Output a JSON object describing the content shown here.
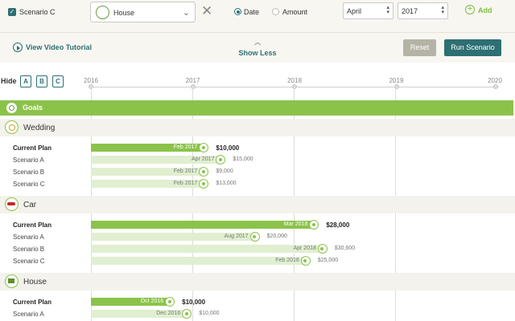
{
  "scenario": {
    "label": "Scenario C",
    "checked": true
  },
  "goal_select": {
    "value": "House"
  },
  "mode": {
    "date_label": "Date",
    "amount_label": "Amount",
    "selected": "Date"
  },
  "month_select": {
    "value": "April"
  },
  "year_select": {
    "value": "2017"
  },
  "add_label": "Add",
  "video_link": "View Video Tutorial",
  "show_less": "Show Less",
  "reset_label": "Reset",
  "run_label": "Run Scenario",
  "hide_label": "Hide",
  "hide_buttons": [
    "A",
    "B",
    "C"
  ],
  "timeline_years": [
    "2016",
    "2017",
    "2018",
    "2019",
    "2020"
  ],
  "goals_title": "Goals",
  "colors": {
    "accent_green": "#8bc34a",
    "teal": "#2e6f73",
    "light_green": "#e0efd0"
  },
  "sections": [
    {
      "title": "Wedding",
      "icon": "ring-icon",
      "rows": [
        {
          "label": "Current Plan",
          "date": "Feb 2017",
          "amount": "$10,000",
          "main": true
        },
        {
          "label": "Scenario A",
          "date": "Apr 2017",
          "amount": "$15,000"
        },
        {
          "label": "Scenario B",
          "date": "Feb 2017",
          "amount": "$9,000"
        },
        {
          "label": "Scenario C",
          "date": "Feb 2017",
          "amount": "$13,000"
        }
      ]
    },
    {
      "title": "Car",
      "icon": "car-icon",
      "rows": [
        {
          "label": "Current Plan",
          "date": "Mar 2018",
          "amount": "$28,000",
          "main": true
        },
        {
          "label": "Scenario A",
          "date": "Aug 2017",
          "amount": "$20,000"
        },
        {
          "label": "Scenario B",
          "date": "Apr 2018",
          "amount": "$30,600"
        },
        {
          "label": "Scenario C",
          "date": "Feb 2018",
          "amount": "$25,000"
        }
      ]
    },
    {
      "title": "House",
      "icon": "house-icon",
      "rows": [
        {
          "label": "Current Plan",
          "date": "Oct 2016",
          "amount": "$10,000",
          "main": true
        },
        {
          "label": "Scenario A",
          "date": "Dec 2016",
          "amount": "$10,000"
        }
      ]
    }
  ]
}
